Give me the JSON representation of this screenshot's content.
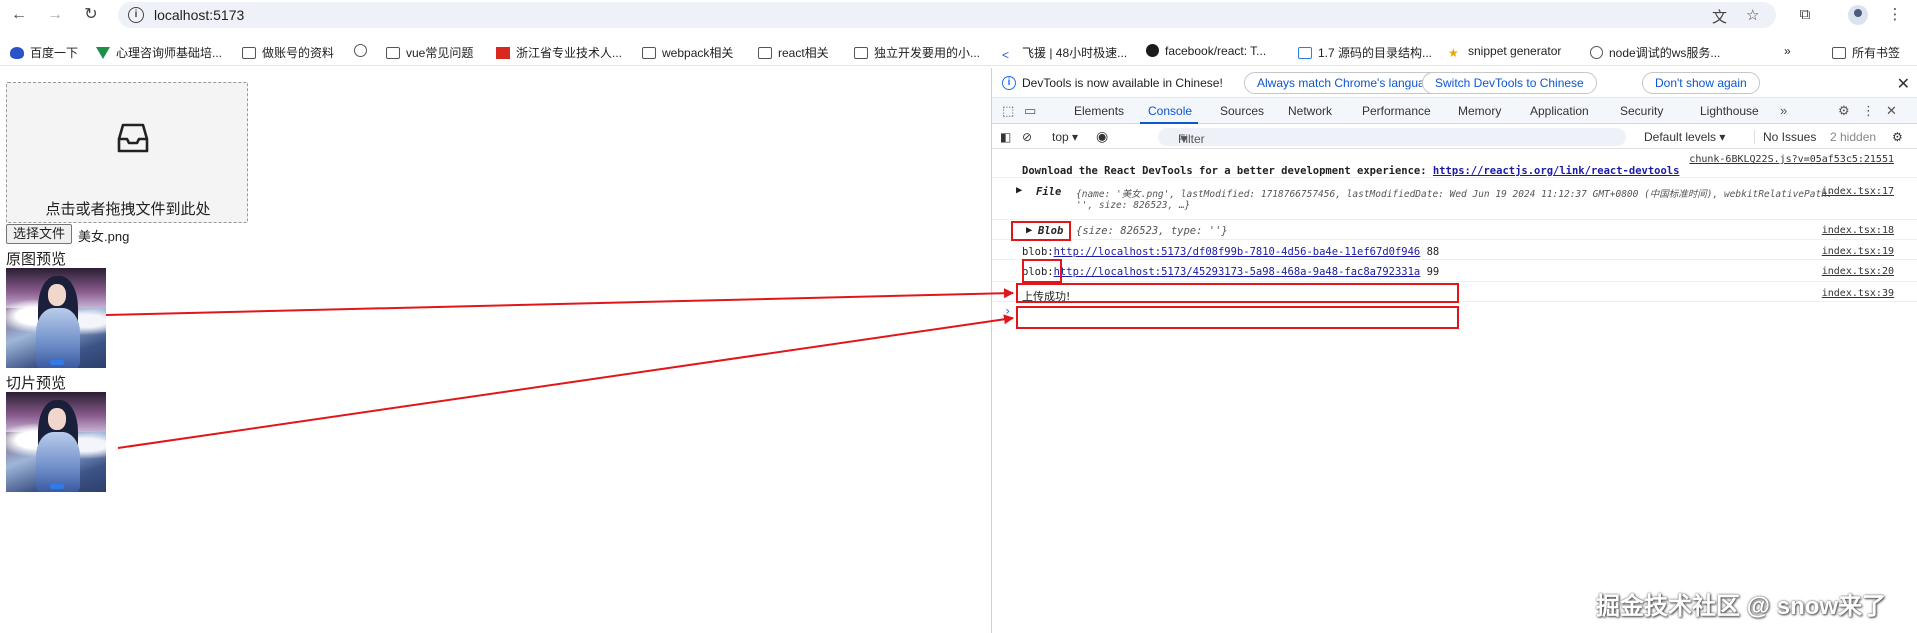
{
  "browser": {
    "url": "localhost:5173",
    "bookmarks": [
      {
        "label": "百度一下",
        "icon": "paw-icon"
      },
      {
        "label": "心理咨询师基础培...",
        "icon": "vue-icon"
      },
      {
        "label": "做账号的资料",
        "icon": "folder-icon"
      },
      {
        "label": "",
        "icon": "globe-icon"
      },
      {
        "label": "vue常见问题",
        "icon": "folder-icon"
      },
      {
        "label": "浙江省专业技术人...",
        "icon": "red-square-icon"
      },
      {
        "label": "webpack相关",
        "icon": "folder-icon"
      },
      {
        "label": "react相关",
        "icon": "folder-icon"
      },
      {
        "label": "独立开发要用的小...",
        "icon": "folder-icon"
      },
      {
        "label": "飞援 | 48小时极速...",
        "icon": "feiyuan-icon"
      },
      {
        "label": "facebook/react: T...",
        "icon": "github-icon"
      },
      {
        "label": "1.7 源码的目录结构...",
        "icon": "bilibili-icon"
      },
      {
        "label": "snippet generator",
        "icon": "star-icon"
      },
      {
        "label": "node调试的ws服务...",
        "icon": "globe-icon"
      },
      {
        "label": "所有书签",
        "icon": "folder-icon"
      }
    ]
  },
  "page": {
    "dropzone_hint": "点击或者拖拽文件到此处",
    "file_button": "选择文件",
    "file_name": "美女.png",
    "original_preview_label": "原图预览",
    "slice_preview_label": "切片预览"
  },
  "devtools": {
    "info_message": "DevTools is now available in Chinese!",
    "info_buttons": [
      "Always match Chrome's language",
      "Switch DevTools to Chinese",
      "Don't show again"
    ],
    "tabs": [
      "Elements",
      "Console",
      "Sources",
      "Network",
      "Performance",
      "Memory",
      "Application",
      "Security",
      "Lighthouse"
    ],
    "active_tab": "Console",
    "toolbar": {
      "context": "top",
      "filter_placeholder": "Filter",
      "levels": "Default levels",
      "issues": "No Issues",
      "hidden": "2 hidden"
    },
    "console": {
      "react_src": "chunk-6BKLQ22S.js?v=05af53c5:21551",
      "react_msg": "Download the React DevTools for a better development experience: ",
      "react_link": "https://reactjs.org/link/react-devtools",
      "file_src": "index.tsx:17",
      "file_label": "File",
      "file_obj_1": "{name: '美女.png', lastModified: 1718766757456, lastModifiedDate: Wed Jun 19 2024 11:12:37 GMT+0800 (中国标准时间), webkitRelativePath:",
      "file_obj_2": "'', size: 826523, …}",
      "blob_src": "index.tsx:18",
      "blob_label": "Blob",
      "blob_obj": "{size: 826523, type: ''}",
      "url1_src": "index.tsx:19",
      "url1_prefix": "blob:",
      "url1_link": "http://localhost:5173/df08f99b-7810-4d56-ba4e-11ef67d0f946",
      "url1_num": "88",
      "url2_src": "index.tsx:20",
      "url2_prefix": "blob:",
      "url2_link": "http://localhost:5173/45293173-5a98-468a-9a48-fac8a792331a",
      "url2_num": "99",
      "success_src": "index.tsx:39",
      "success_msg": "上传成功!"
    }
  },
  "watermark": "掘金技术社区 @ snow来了",
  "annotation_color": "#e0161b"
}
